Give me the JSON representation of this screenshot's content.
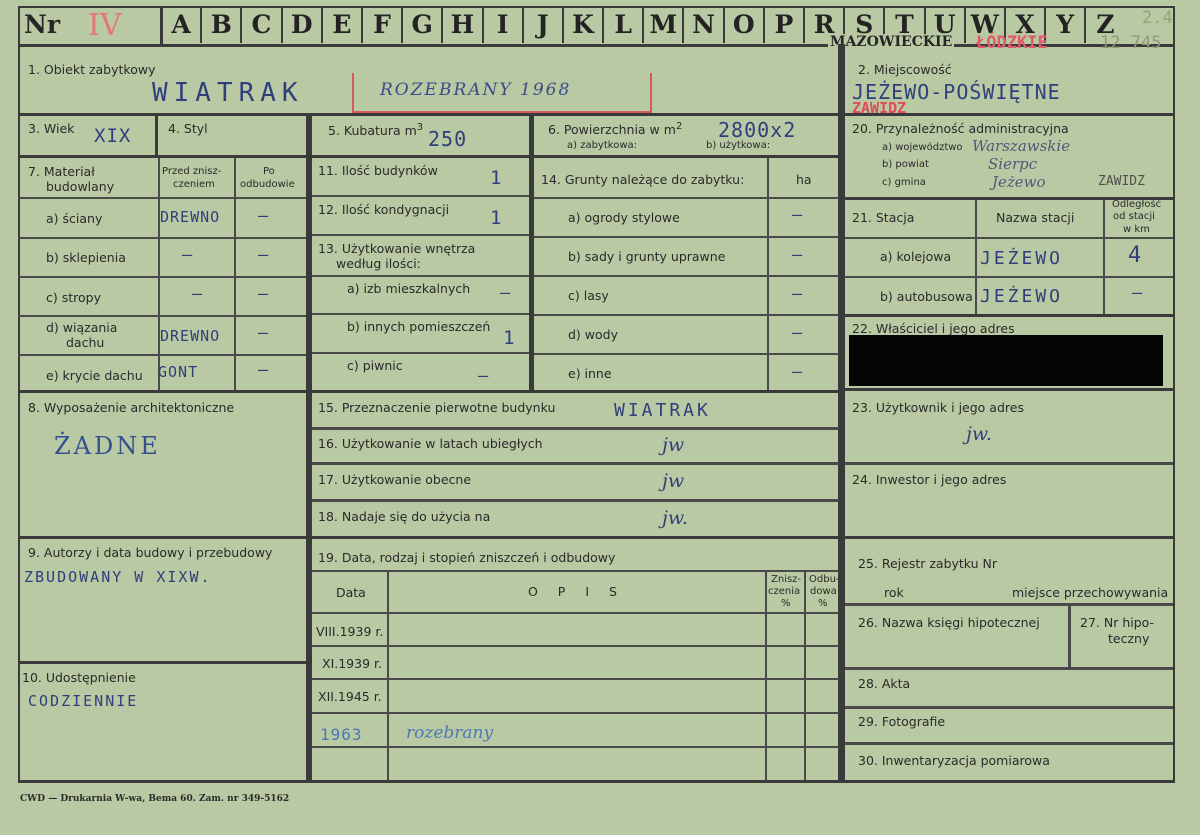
{
  "header": {
    "nr_label": "Nr",
    "nr_value": "IV",
    "letters": [
      "A",
      "B",
      "C",
      "D",
      "E",
      "F",
      "G",
      "H",
      "I",
      "J",
      "K",
      "L",
      "M",
      "N",
      "O",
      "P",
      "R",
      "S",
      "T",
      "U",
      "W",
      "X",
      "Y",
      "Z"
    ],
    "region_stamp": "MAZOWIECKIE",
    "region_red": "ŁÓDZKIE",
    "ref_top": "2.4",
    "ref_bottom": "12 745"
  },
  "f1": {
    "label": "1. Obiekt zabytkowy",
    "value": "WIATRAK",
    "stamp": "ROZEBRANY 1968"
  },
  "f2": {
    "label": "2. Miejscowość",
    "value": "JEŻEWO-POŚWIĘTNE",
    "red": "ZAWIDZ"
  },
  "f3": {
    "label": "3. Wiek",
    "value": "XIX"
  },
  "f4": {
    "label": "4. Styl"
  },
  "f5": {
    "label": "5. Kubatura m",
    "sup": "3",
    "value": "250"
  },
  "f6": {
    "label": "6. Powierzchnia w m",
    "sup": "2",
    "value": "2800x2",
    "sub_a": "a) zabytkowa:",
    "sub_b": "b) użytkowa:"
  },
  "f20": {
    "label": "20. Przynależność administracyjna",
    "a": "a) województwo",
    "b": "b) powiat",
    "c": "c) gmina",
    "a_val": "Warszawskie",
    "b_val": "Sierpc",
    "c_val": "Jeżewo",
    "c_extra": "ZAWIDZ"
  },
  "f7": {
    "label1": "7. Materiał",
    "label2": "budowlany",
    "col1a": "Przed znisz-",
    "col1b": "czeniem",
    "col2a": "Po",
    "col2b": "odbudowie",
    "rows": [
      {
        "label": "a) ściany",
        "before": "DREWNO",
        "after": "—"
      },
      {
        "label": "b) sklepienia",
        "before": "—",
        "after": "—"
      },
      {
        "label": "c) stropy",
        "before": "—",
        "after": "—"
      },
      {
        "label": "d) wiązania",
        "label2": "dachu",
        "before": "DREWNO",
        "after": "—"
      },
      {
        "label": "e) krycie dachu",
        "before": "GONT",
        "after": "—"
      }
    ]
  },
  "f11": {
    "label": "11. Ilość budynków",
    "value": "1"
  },
  "f12": {
    "label": "12. Ilość kondygnacji",
    "value": "1"
  },
  "f13": {
    "label1": "13. Użytkowanie wnętrza",
    "label2": "według ilości:",
    "a": "a) izb mieszkalnych",
    "a_val": "—",
    "b": "b) innych pomieszczeń",
    "b_val": "1",
    "c": "c) piwnic",
    "c_val": "—"
  },
  "f14": {
    "label": "14. Grunty należące do zabytku:",
    "unit": "ha",
    "rows": [
      {
        "label": "a) ogrody stylowe",
        "value": "—"
      },
      {
        "label": "b) sady i grunty uprawne",
        "value": "—"
      },
      {
        "label": "c) lasy",
        "value": "—"
      },
      {
        "label": "d) wody",
        "value": "—"
      },
      {
        "label": "e) inne",
        "value": "—"
      }
    ]
  },
  "f21": {
    "label": "21. Stacja",
    "col_name": "Nazwa stacji",
    "col_dist1": "Odległość",
    "col_dist2": "od stacji",
    "col_dist3": "w km",
    "rail_label": "a) kolejowa",
    "rail_name": "JEŻEWO",
    "rail_dist": "4",
    "bus_label": "b) autobusowa",
    "bus_name": "JEŻEWO",
    "bus_dist": "—"
  },
  "f22": {
    "label": "22. Właściciel i jego adres"
  },
  "f8": {
    "label": "8. Wyposażenie architektoniczne",
    "value": "ŻADNE"
  },
  "f15": {
    "label": "15. Przeznaczenie pierwotne budynku",
    "value": "WIATRAK"
  },
  "f16": {
    "label": "16. Użytkowanie w latach ubiegłych",
    "value": "jw"
  },
  "f17": {
    "label": "17. Użytkowanie obecne",
    "value": "jw"
  },
  "f18": {
    "label": "18. Nadaje się do użycia na",
    "value": "jw."
  },
  "f23": {
    "label": "23. Użytkownik i jego adres",
    "value": "jw."
  },
  "f24": {
    "label": "24. Inwestor i jego adres"
  },
  "f9": {
    "label": "9. Autorzy i data budowy i przebudowy",
    "value": "ZBUDOWANY W XIXW."
  },
  "f19": {
    "label": "19. Data, rodzaj i stopień zniszczeń i odbudowy",
    "col_date": "Data",
    "col_desc": "O P I S",
    "col_z1": "Znisz-",
    "col_z2": "czenia",
    "col_z3": "%",
    "col_o1": "Odbu-",
    "col_o2": "dowa",
    "col_o3": "%",
    "rows": [
      {
        "date": "VIII.1939 r.",
        "desc": ""
      },
      {
        "date": "XI.1939 r.",
        "desc": ""
      },
      {
        "date": "XII.1945 r.",
        "desc": ""
      },
      {
        "date": "1963",
        "desc": "rozebrany"
      }
    ]
  },
  "f25": {
    "label": "25. Rejestr zabytku Nr",
    "rok": "rok",
    "miejsce": "miejsce przechowywania"
  },
  "f26": {
    "label": "26. Nazwa księgi hipotecznej"
  },
  "f27": {
    "label1": "27. Nr hipo-",
    "label2": "teczny"
  },
  "f10": {
    "label": "10. Udostępnienie",
    "value": "CODZIENNIE"
  },
  "f28": {
    "label": "28. Akta"
  },
  "f29": {
    "label": "29. Fotografie"
  },
  "f30": {
    "label": "30. Inwentaryzacja pomiarowa"
  },
  "footer": {
    "printer": "CWD — Drukarnia W-wa, Bema 60. Zam. nr 349-5162"
  },
  "colors": {
    "paper": "#b9c9a3",
    "ink_blue": "#2f3f7c",
    "ink_red": "#d65a5a"
  }
}
